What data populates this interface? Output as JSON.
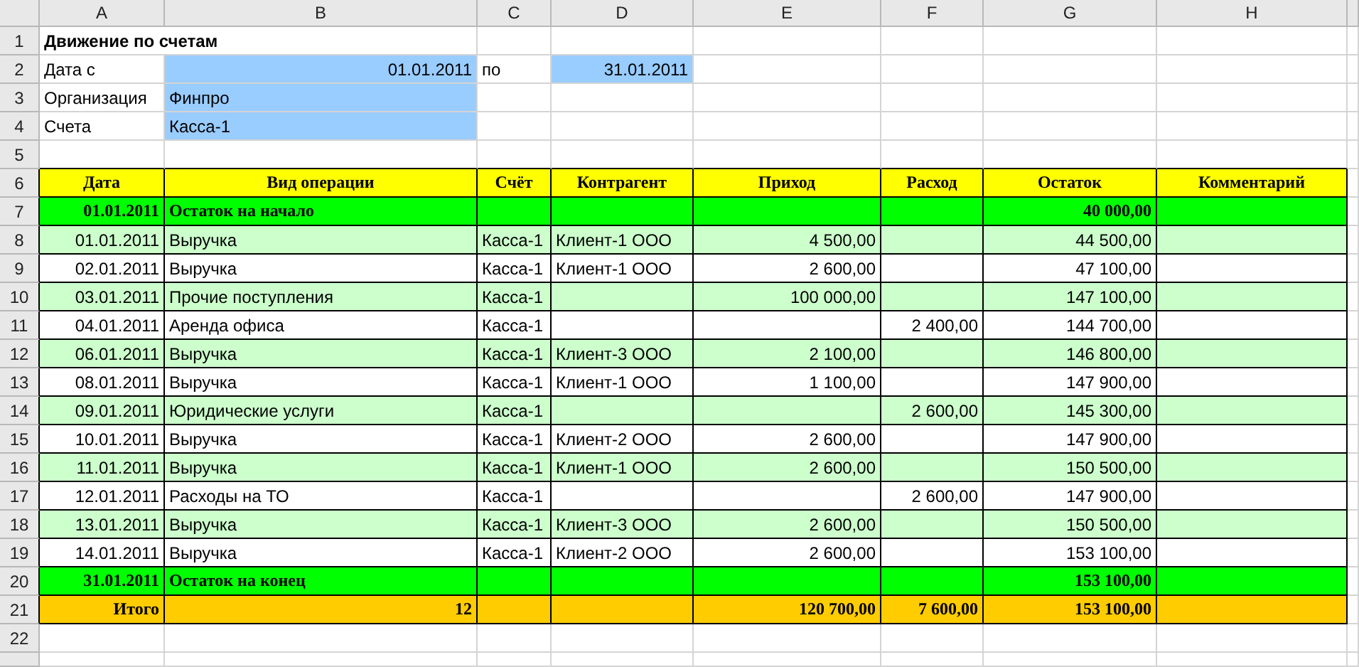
{
  "sheet": {
    "columns": [
      "A",
      "B",
      "C",
      "D",
      "E",
      "F",
      "G",
      "H"
    ],
    "row_numbers": [
      "1",
      "2",
      "3",
      "4",
      "5",
      "6",
      "7",
      "8",
      "9",
      "10",
      "11",
      "12",
      "13",
      "14",
      "15",
      "16",
      "17",
      "18",
      "19",
      "20",
      "21",
      "22"
    ]
  },
  "title": "Движение по счетам",
  "period": {
    "label": "Дата с",
    "from": "01.01.2011",
    "to_label": "по",
    "to": "31.01.2011"
  },
  "organization": {
    "label": "Организация",
    "value": "Финпро"
  },
  "accounts": {
    "label": "Счета",
    "value": "Касса-1"
  },
  "table": {
    "columns": [
      "Дата",
      "Вид операции",
      "Счёт",
      "Контрагент",
      "Приход",
      "Расход",
      "Остаток",
      "Комментарий"
    ],
    "rows": [
      {
        "kind": "opening",
        "date": "01.01.2011",
        "operation": "Остаток на начало",
        "balance": "40 000,00"
      },
      {
        "kind": "entry",
        "shaded": true,
        "date": "01.01.2011",
        "operation": "Выручка",
        "account": "Касса-1",
        "counterparty": "Клиент-1 ООО",
        "income": "4 500,00",
        "balance": "44 500,00"
      },
      {
        "kind": "entry",
        "shaded": false,
        "date": "02.01.2011",
        "operation": "Выручка",
        "account": "Касса-1",
        "counterparty": "Клиент-1 ООО",
        "income": "2 600,00",
        "balance": "47 100,00"
      },
      {
        "kind": "entry",
        "shaded": true,
        "date": "03.01.2011",
        "operation": "Прочие поступления",
        "account": "Касса-1",
        "income": "100 000,00",
        "balance": "147 100,00"
      },
      {
        "kind": "entry",
        "shaded": false,
        "date": "04.01.2011",
        "operation": "Аренда офиса",
        "account": "Касса-1",
        "expense": "2 400,00",
        "balance": "144 700,00"
      },
      {
        "kind": "entry",
        "shaded": true,
        "date": "06.01.2011",
        "operation": "Выручка",
        "account": "Касса-1",
        "counterparty": "Клиент-3 ООО",
        "income": "2 100,00",
        "balance": "146 800,00"
      },
      {
        "kind": "entry",
        "shaded": false,
        "date": "08.01.2011",
        "operation": "Выручка",
        "account": "Касса-1",
        "counterparty": "Клиент-1 ООО",
        "income": "1 100,00",
        "balance": "147 900,00"
      },
      {
        "kind": "entry",
        "shaded": true,
        "date": "09.01.2011",
        "operation": "Юридические услуги",
        "account": "Касса-1",
        "expense": "2 600,00",
        "balance": "145 300,00"
      },
      {
        "kind": "entry",
        "shaded": false,
        "date": "10.01.2011",
        "operation": "Выручка",
        "account": "Касса-1",
        "counterparty": "Клиент-2 ООО",
        "income": "2 600,00",
        "balance": "147 900,00"
      },
      {
        "kind": "entry",
        "shaded": true,
        "date": "11.01.2011",
        "operation": "Выручка",
        "account": "Касса-1",
        "counterparty": "Клиент-1 ООО",
        "income": "2 600,00",
        "balance": "150 500,00"
      },
      {
        "kind": "entry",
        "shaded": false,
        "date": "12.01.2011",
        "operation": "Расходы на ТО",
        "account": "Касса-1",
        "expense": "2 600,00",
        "balance": "147 900,00"
      },
      {
        "kind": "entry",
        "shaded": true,
        "date": "13.01.2011",
        "operation": "Выручка",
        "account": "Касса-1",
        "counterparty": "Клиент-3 ООО",
        "income": "2 600,00",
        "balance": "150 500,00"
      },
      {
        "kind": "entry",
        "shaded": false,
        "date": "14.01.2011",
        "operation": "Выручка",
        "account": "Касса-1",
        "counterparty": "Клиент-2 ООО",
        "income": "2 600,00",
        "balance": "153 100,00"
      },
      {
        "kind": "closing",
        "date": "31.01.2011",
        "operation": "Остаток на конец",
        "balance": "153 100,00"
      },
      {
        "kind": "total",
        "label": "Итого",
        "count": "12",
        "income": "120 700,00",
        "expense": "7 600,00",
        "balance": "153 100,00"
      }
    ]
  }
}
